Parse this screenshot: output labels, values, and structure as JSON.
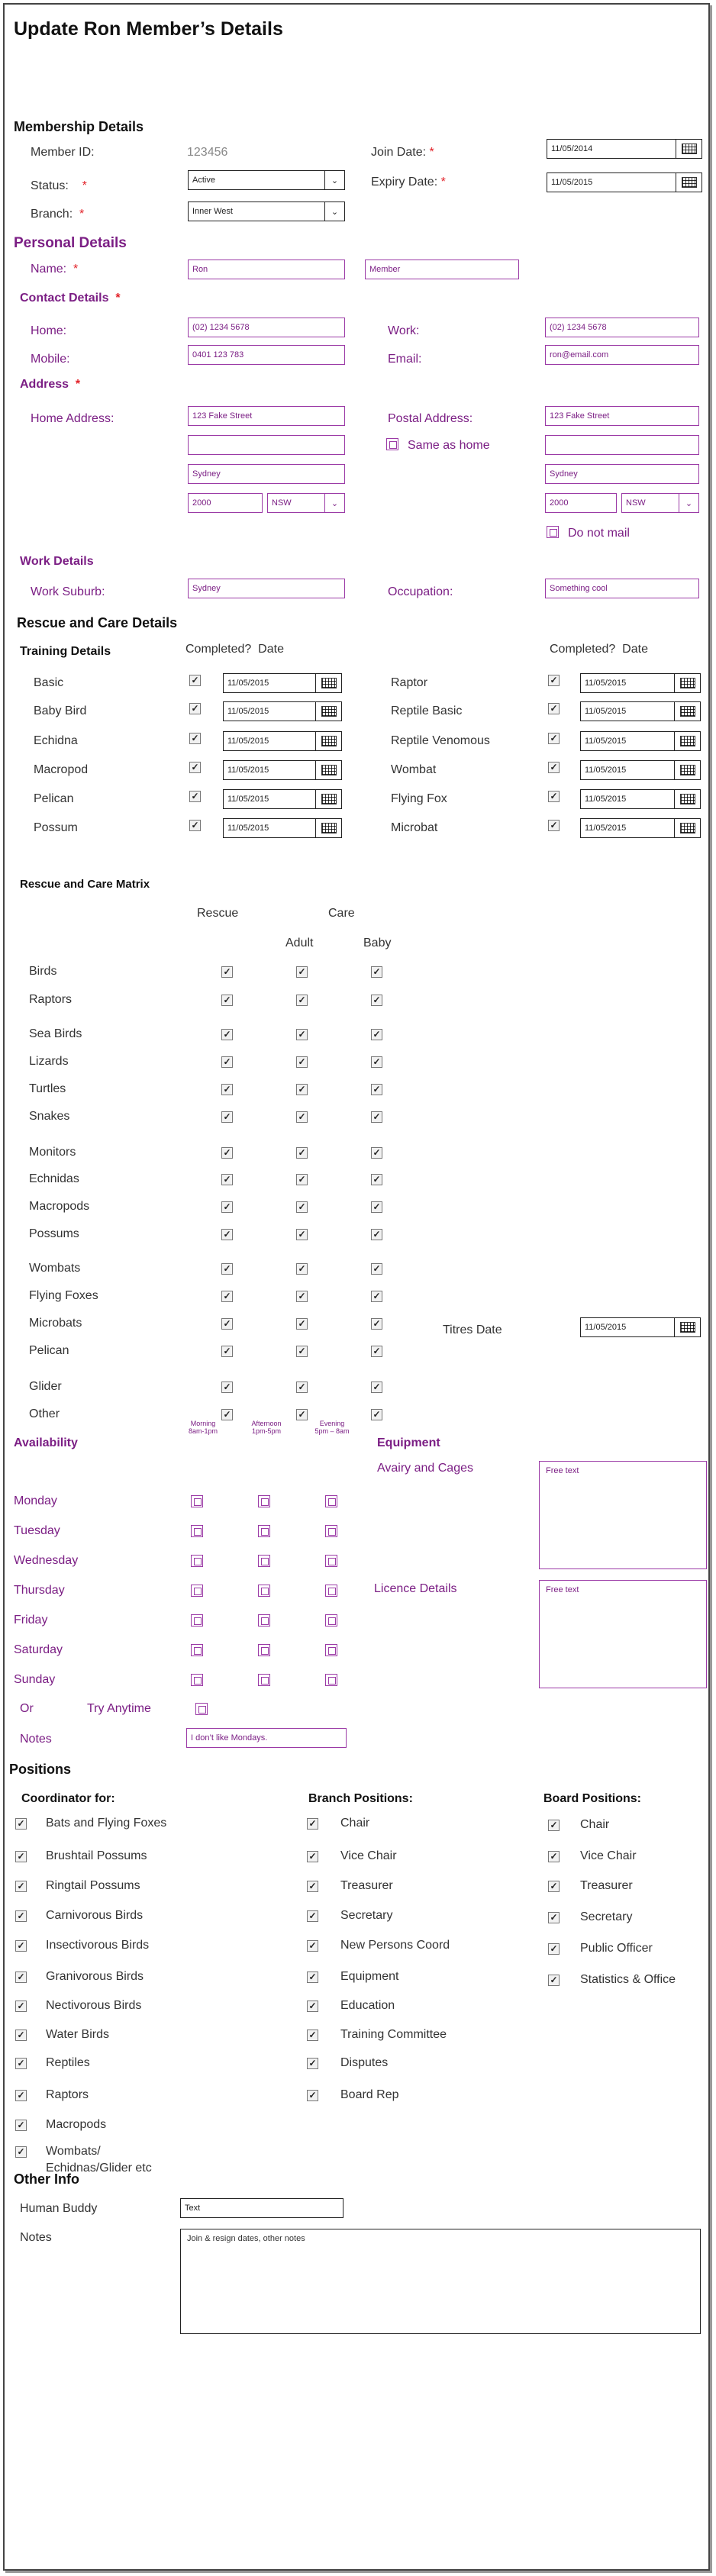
{
  "title": "Update Ron Member’s Details",
  "membership": {
    "heading": "Membership Details",
    "member_id_label": "Member ID:",
    "member_id": "123456",
    "join_label": "Join Date:",
    "join_date": "11/05/2014",
    "status_label": "Status:",
    "status": "Active",
    "expiry_label": "Expiry Date:",
    "expiry_date": "11/05/2015",
    "branch_label": "Branch:",
    "branch": "Inner West",
    "req": "*"
  },
  "personal": {
    "heading": "Personal Details",
    "name_label": "Name:",
    "first_name": "Ron",
    "last_name": "Member"
  },
  "contact": {
    "heading": "Contact Details",
    "home_label": "Home:",
    "home": "(02) 1234 5678",
    "work_label": "Work:",
    "work": "(02) 1234 5678",
    "mobile_label": "Mobile:",
    "mobile": "0401 123 783",
    "email_label": "Email:",
    "email": "ron@email.com"
  },
  "address": {
    "heading": "Address",
    "home_label": "Home Address:",
    "home_street": "123 Fake Street",
    "home_suburb": "Sydney",
    "home_postcode": "2000",
    "home_state": "NSW",
    "postal_label": "Postal Address:",
    "postal_street": "123 Fake Street",
    "postal_suburb": "Sydney",
    "postal_postcode": "2000",
    "postal_state": "NSW",
    "same_as_home": "Same as home",
    "do_not_mail": "Do not mail"
  },
  "work_details": {
    "heading": "Work Details",
    "suburb_label": "Work Suburb:",
    "suburb": "Sydney",
    "occupation_label": "Occupation:",
    "occupation": "Something cool"
  },
  "rescue": {
    "heading": "Rescue and Care Details",
    "training_heading": "Training Details",
    "completed_label": "Completed?",
    "date_label": "Date",
    "left": [
      {
        "name": "Basic",
        "date": "11/05/2015"
      },
      {
        "name": "Baby Bird",
        "date": "11/05/2015"
      },
      {
        "name": "Echidna",
        "date": "11/05/2015"
      },
      {
        "name": "Macropod",
        "date": "11/05/2015"
      },
      {
        "name": "Pelican",
        "date": "11/05/2015"
      },
      {
        "name": "Possum",
        "date": "11/05/2015"
      }
    ],
    "right": [
      {
        "name": "Raptor",
        "date": "11/05/2015"
      },
      {
        "name": "Reptile Basic",
        "date": "11/05/2015"
      },
      {
        "name": "Reptile Venomous",
        "date": "11/05/2015"
      },
      {
        "name": "Wombat",
        "date": "11/05/2015"
      },
      {
        "name": "Flying Fox",
        "date": "11/05/2015"
      },
      {
        "name": "Microbat",
        "date": "11/05/2015"
      }
    ]
  },
  "matrix": {
    "heading": "Rescue and Care Matrix",
    "rescue_col": "Rescue",
    "care_col": "Care",
    "adult_col": "Adult",
    "baby_col": "Baby",
    "titres_label": "Titres Date",
    "titres_date": "11/05/2015",
    "rows": [
      "Birds",
      "Raptors",
      "Sea Birds",
      "Lizards",
      "Turtles",
      "Snakes",
      "Monitors",
      "Echnidas",
      "Macropods",
      "Possums",
      "Wombats",
      "Flying Foxes",
      "Microbats",
      "Pelican",
      "Glider",
      "Other"
    ]
  },
  "availability": {
    "heading": "Availability",
    "morning": "Morning",
    "morning_time": "8am-1pm",
    "afternoon": "Afternoon",
    "afternoon_time": "1pm-5pm",
    "evening": "Evening",
    "evening_time": "5pm – 8am",
    "days": [
      "Monday",
      "Tuesday",
      "Wednesday",
      "Thursday",
      "Friday",
      "Saturday",
      "Sunday"
    ],
    "or_label": "Or",
    "try_anytime": "Try Anytime",
    "notes_label": "Notes",
    "notes": "I don’t like Mondays."
  },
  "equipment": {
    "heading": "Equipment",
    "aviary_label": "Avairy and Cages",
    "aviary_text": "Free text",
    "licence_label": "Licence Details",
    "licence_text": "Free text"
  },
  "positions": {
    "heading": "Positions",
    "coord_heading": "Coordinator for:",
    "coord": [
      "Bats and Flying Foxes",
      "Brushtail Possums",
      "Ringtail Possums",
      "Carnivorous Birds",
      "Insectivorous Birds",
      "Granivorous Birds",
      "Nectivorous Birds",
      "Water Birds",
      "Reptiles",
      "Raptors",
      "Macropods",
      "Wombats/",
      "Echidnas/Glider etc"
    ],
    "branch_heading": "Branch Positions:",
    "branch": [
      "Chair",
      "Vice Chair",
      "Treasurer",
      "Secretary",
      "New Persons Coord",
      "Equipment",
      "Education",
      "Training Committee",
      "Disputes",
      "Board Rep"
    ],
    "board_heading": "Board Positions:",
    "board": [
      "Chair",
      "Vice Chair",
      "Treasurer",
      "Secretary",
      "Public Officer",
      "Statistics & Office"
    ]
  },
  "other": {
    "heading": "Other Info",
    "buddy_label": "Human Buddy",
    "buddy": "Text",
    "notes_label": "Notes",
    "notes": "Join & resign dates, other notes"
  },
  "icons": {
    "check": "check-icon",
    "calendar": "calendar-icon",
    "dropdown": "chevron-down-icon"
  },
  "colors": {
    "accent": "#7b1e84",
    "required": "#e21f26"
  }
}
